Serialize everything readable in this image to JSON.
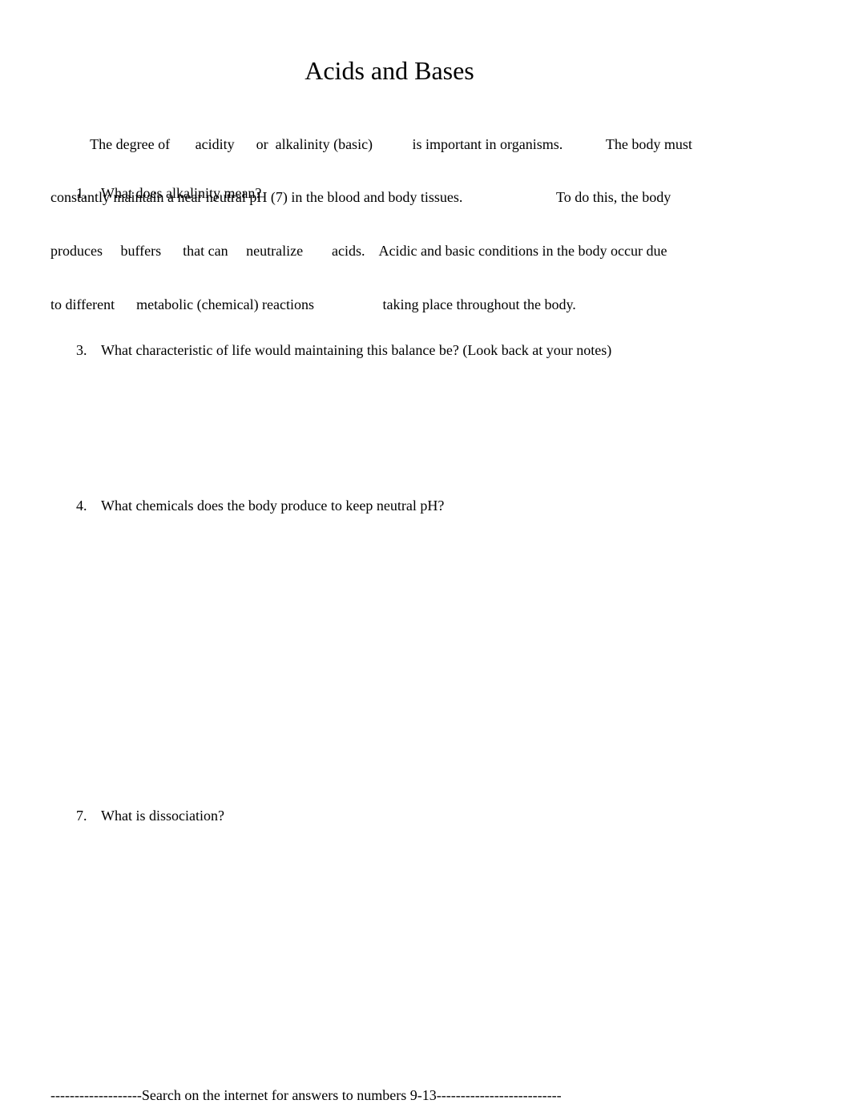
{
  "document": {
    "title": "Acids and Bases",
    "intro_lines": [
      "           The degree of       acidity      or  alkalinity (basic)           is important in organisms.            The body must",
      "constantly maintain a near neutral pH (7) in the blood and body tissues.                          To do this, the body",
      "produces     buffers      that can     neutralize        acids.    Acidic and basic conditions in the body occur due",
      "to different      metabolic (chemical) reactions                   taking place throughout the body."
    ],
    "questions": [
      {
        "number": "1.",
        "text": "What does alkalinity mean?"
      },
      {
        "number": "3.",
        "text": "What characteristic of life would maintaining this balance be? (Look back at your notes)"
      },
      {
        "number": "4.",
        "text": "What chemicals does the body produce to keep neutral pH?"
      },
      {
        "number": "7.",
        "text": "What is dissociation?"
      }
    ],
    "footer": "-------------------Search on the internet for answers to numbers 9-13--------------------------"
  }
}
